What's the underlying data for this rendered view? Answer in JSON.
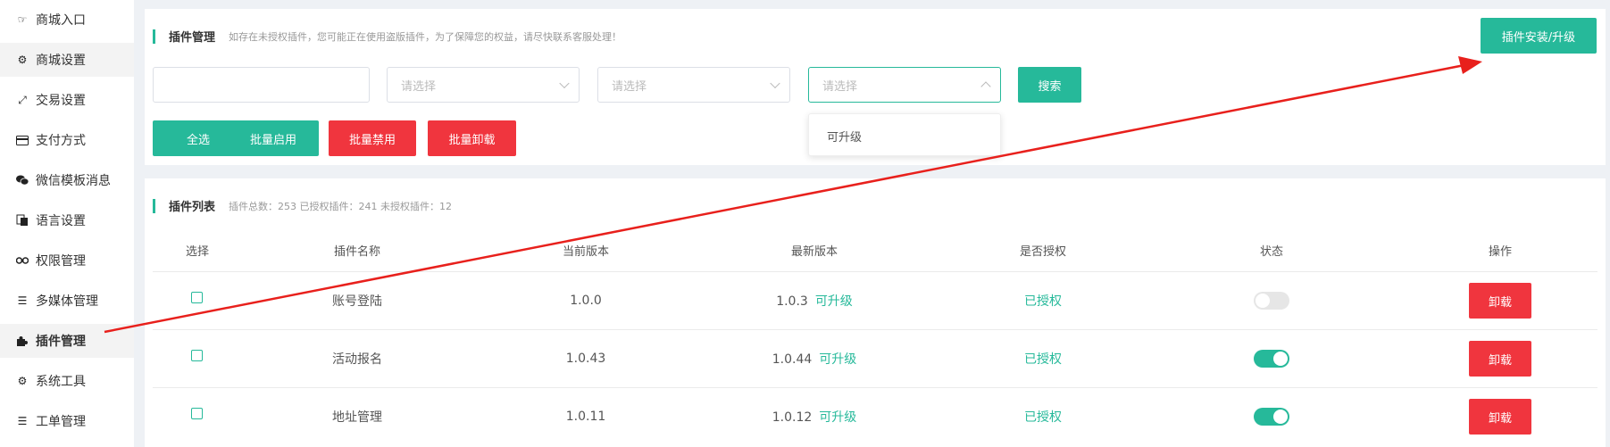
{
  "sidebar": {
    "items": [
      {
        "label": "商城入口",
        "icon": "hand-pointer-icon"
      },
      {
        "label": "商城设置",
        "icon": "gear-icon"
      },
      {
        "label": "交易设置",
        "icon": "exchange-icon"
      },
      {
        "label": "支付方式",
        "icon": "credit-card-icon"
      },
      {
        "label": "微信模板消息",
        "icon": "wechat-icon"
      },
      {
        "label": "语言设置",
        "icon": "translate-icon"
      },
      {
        "label": "权限管理",
        "icon": "key-icon"
      },
      {
        "label": "多媒体管理",
        "icon": "list-icon"
      },
      {
        "label": "插件管理",
        "icon": "puzzle-icon"
      },
      {
        "label": "系统工具",
        "icon": "gear-icon"
      },
      {
        "label": "工单管理",
        "icon": "list-icon"
      }
    ]
  },
  "plugin_manage": {
    "title": "插件管理",
    "note": "如存在未授权插件，您可能正在使用盗版插件，为了保障您的权益，请尽快联系客服处理！",
    "install_label": "插件安装/升级",
    "search_input": {
      "value": "",
      "placeholder": ""
    },
    "select1": {
      "placeholder": "请选择"
    },
    "select2": {
      "placeholder": "请选择"
    },
    "select3": {
      "placeholder": "请选择",
      "options": [
        "可升级"
      ]
    },
    "search_label": "搜索",
    "select_all_label": "全选",
    "batch_enable_label": "批量启用",
    "batch_disable_label": "批量禁用",
    "batch_uninstall_label": "批量卸载"
  },
  "plugin_list": {
    "title": "插件列表",
    "stats": "插件总数：253 已授权插件：241 未授权插件：12",
    "columns": [
      "选择",
      "插件名称",
      "当前版本",
      "最新版本",
      "是否授权",
      "状态",
      "操作"
    ],
    "rows": [
      {
        "name": "账号登陆",
        "current": "1.0.0",
        "latest": "1.0.3",
        "upgrade": "可升级",
        "auth": "已授权",
        "enabled": false,
        "action": "卸载"
      },
      {
        "name": "活动报名",
        "current": "1.0.43",
        "latest": "1.0.44",
        "upgrade": "可升级",
        "auth": "已授权",
        "enabled": true,
        "action": "卸载"
      },
      {
        "name": "地址管理",
        "current": "1.0.11",
        "latest": "1.0.12",
        "upgrade": "可升级",
        "auth": "已授权",
        "enabled": true,
        "action": "卸载"
      }
    ]
  },
  "colors": {
    "accent": "#26b99a",
    "danger": "#f0353e",
    "annotation_arrow": "#e8201c"
  }
}
